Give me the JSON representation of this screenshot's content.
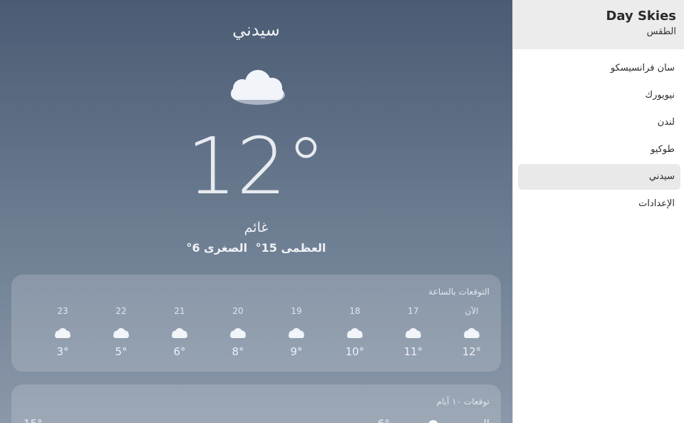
{
  "current": {
    "city": "سيدني",
    "temp": "12°",
    "condition": "غائم",
    "high": "العظمى 15°",
    "low": "الصغرى 6°",
    "icon": "cloud-icon"
  },
  "hourly": {
    "title": "التوقعات بالساعة",
    "items": [
      {
        "label": "الآن",
        "temp": "12°",
        "icon": "cloud-icon"
      },
      {
        "label": "17",
        "temp": "11°",
        "icon": "cloud-icon"
      },
      {
        "label": "18",
        "temp": "10°",
        "icon": "cloud-icon"
      },
      {
        "label": "19",
        "temp": "9°",
        "icon": "cloud-icon"
      },
      {
        "label": "20",
        "temp": "8°",
        "icon": "cloud-icon"
      },
      {
        "label": "21",
        "temp": "6°",
        "icon": "cloud-icon"
      },
      {
        "label": "22",
        "temp": "5°",
        "icon": "cloud-icon"
      },
      {
        "label": "23",
        "temp": "3°",
        "icon": "cloud-icon"
      }
    ]
  },
  "daily": {
    "title": "توقعات ١٠ أيام",
    "first_day": {
      "name": "اليوم",
      "low": "15°",
      "high": "6°",
      "icon": "sun-icon"
    }
  },
  "sidebar": {
    "app_name": "Day Skies",
    "subtitle": "الطقس",
    "items": [
      {
        "label": "سان فرانسيسكو",
        "active": false
      },
      {
        "label": "نيويورك",
        "active": false
      },
      {
        "label": "لندن",
        "active": false
      },
      {
        "label": "طوكيو",
        "active": false
      },
      {
        "label": "سيدني",
        "active": true
      },
      {
        "label": "الإعدادات",
        "active": false
      }
    ]
  },
  "colors": {
    "sky_top": "#4a5b73",
    "sky_bottom": "#8a98a9",
    "sidebar_header": "#ececec",
    "active_item": "#e9e9e9"
  }
}
